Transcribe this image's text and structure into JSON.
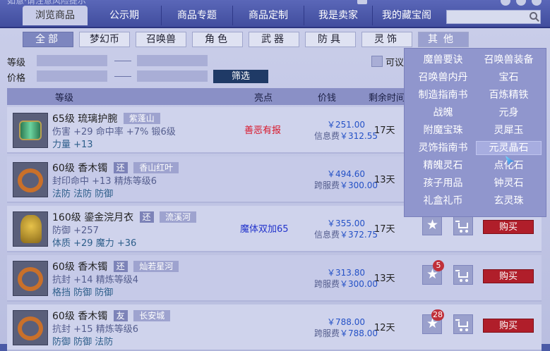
{
  "top_bar": {
    "faded_title": "如意·请注意风险提示"
  },
  "tabs": [
    "浏览商品",
    "公示期",
    "商品专题",
    "商品定制",
    "我是卖家",
    "我的藏宝阁"
  ],
  "search": {
    "placeholder": ""
  },
  "categories": [
    "全部",
    "梦幻币",
    "召唤兽",
    "角色",
    "武器",
    "防具",
    "灵饰",
    "其他"
  ],
  "filter": {
    "level_label": "等级",
    "price_label": "价格",
    "button": "筛选",
    "checkbox_label": "可议"
  },
  "table_header": {
    "level": "等级",
    "highlight": "亮点",
    "price": "价钱",
    "remaining": "剩余时间"
  },
  "rows": [
    {
      "level": "65级",
      "name": "琉璃护腕",
      "badge": "",
      "server": "紫蓬山",
      "attr1": "伤害 +29 命中率 +7% 锻6级",
      "attr2": "力量 +13",
      "highlight": "善恶有报",
      "price": "￥251.00",
      "fee_label": "信息费",
      "fee": "￥312.55",
      "days": "17天",
      "count": ""
    },
    {
      "level": "60级",
      "name": "香木镯",
      "badge": "还",
      "server": "香山红叶",
      "attr1": "封印命中 +13 精炼等级6",
      "attr2": "法防 法防 防御",
      "highlight": "",
      "price": "￥494.60",
      "fee_label": "跨服费",
      "fee": "￥300.00",
      "days": "13天",
      "count": ""
    },
    {
      "level": "160级",
      "name": "鎏金浣月衣",
      "badge": "还",
      "server": "流溪河",
      "attr1": "防御 +257",
      "attr2": "体质 +29 魔力 +36",
      "highlight": "魔体双加65",
      "price": "￥355.00",
      "fee_label": "信息费",
      "fee": "￥372.75",
      "days": "17天",
      "count": ""
    },
    {
      "level": "60级",
      "name": "香木镯",
      "badge": "还",
      "server": "灿若星河",
      "attr1": "抗封 +14 精炼等级4",
      "attr2": "格挡 防御 防御",
      "highlight": "",
      "price": "￥313.80",
      "fee_label": "跨服费",
      "fee": "￥300.00",
      "days": "13天",
      "count": "5"
    },
    {
      "level": "60级",
      "name": "香木镯",
      "badge": "友",
      "server": "长安城",
      "attr1": "抗封 +15 精炼等级6",
      "attr2": "防御 防御 法防",
      "highlight": "",
      "price": "￥788.00",
      "fee_label": "跨服费",
      "fee": "￥788.00",
      "days": "12天",
      "count": "28"
    }
  ],
  "buy_label": "购买",
  "dropdown": {
    "items": [
      "魔兽要诀",
      "召唤兽装备",
      "召唤兽内丹",
      "宝石",
      "制造指南书",
      "百炼精铁",
      "战魄",
      "元身",
      "附魔宝珠",
      "灵犀玉",
      "灵饰指南书",
      "元灵晶石",
      "精魄灵石",
      "点化石",
      "孩子用品",
      "钟灵石",
      "礼盒礼币",
      "玄灵珠"
    ],
    "hovered": "元灵晶石"
  },
  "colors": {
    "buy": "#b01e2a",
    "highlight_red": "#d9162a",
    "highlight_blue": "#2233cc",
    "price": "#2451c6"
  },
  "icons": [
    "search-icon",
    "star-icon",
    "cart-icon",
    "bracelet-icon",
    "armor-icon"
  ]
}
